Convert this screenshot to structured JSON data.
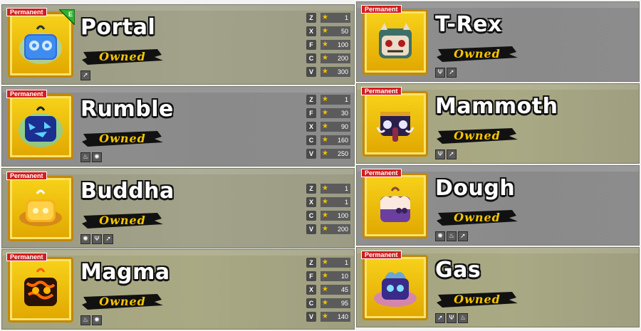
{
  "left_column": [
    {
      "name": "Portal",
      "tag": "Permanent",
      "status": "Owned",
      "badge": "E",
      "icon": "portal-fruit-icon",
      "abilities": [
        "dash-icon"
      ],
      "moves": [
        {
          "key": "Z",
          "mastery": "1"
        },
        {
          "key": "X",
          "mastery": "50"
        },
        {
          "key": "F",
          "mastery": "100"
        },
        {
          "key": "C",
          "mastery": "200"
        },
        {
          "key": "V",
          "mastery": "300"
        }
      ]
    },
    {
      "name": "Rumble",
      "tag": "Permanent",
      "status": "Owned",
      "icon": "rumble-fruit-icon",
      "abilities": [
        "fire-icon",
        "gear-icon"
      ],
      "moves": [
        {
          "key": "Z",
          "mastery": "1"
        },
        {
          "key": "F",
          "mastery": "30"
        },
        {
          "key": "X",
          "mastery": "90"
        },
        {
          "key": "C",
          "mastery": "160"
        },
        {
          "key": "V",
          "mastery": "250"
        }
      ]
    },
    {
      "name": "Buddha",
      "tag": "Permanent",
      "status": "Owned",
      "icon": "buddha-fruit-icon",
      "abilities": [
        "gear-icon",
        "claw-icon",
        "dash-icon"
      ],
      "moves": [
        {
          "key": "Z",
          "mastery": "1"
        },
        {
          "key": "X",
          "mastery": "1"
        },
        {
          "key": "C",
          "mastery": "100"
        },
        {
          "key": "V",
          "mastery": "200"
        }
      ]
    },
    {
      "name": "Magma",
      "tag": "Permanent",
      "status": "Owned",
      "icon": "magma-fruit-icon",
      "abilities": [
        "fire-icon",
        "gear-icon"
      ],
      "moves": [
        {
          "key": "Z",
          "mastery": "1"
        },
        {
          "key": "F",
          "mastery": "10"
        },
        {
          "key": "X",
          "mastery": "45"
        },
        {
          "key": "C",
          "mastery": "95"
        },
        {
          "key": "V",
          "mastery": "140"
        }
      ]
    }
  ],
  "right_column": [
    {
      "name": "T-Rex",
      "tag": "Permanent",
      "status": "Owned",
      "icon": "t-rex-fruit-icon",
      "abilities": [
        "claw-icon",
        "dash-icon"
      ]
    },
    {
      "name": "Mammoth",
      "tag": "Permanent",
      "status": "Owned",
      "icon": "mammoth-fruit-icon",
      "abilities": [
        "claw-icon",
        "dash-icon"
      ]
    },
    {
      "name": "Dough",
      "tag": "Permanent",
      "status": "Owned",
      "icon": "dough-fruit-icon",
      "abilities": [
        "gear-icon",
        "fire-icon",
        "dash-icon"
      ]
    },
    {
      "name": "Gas",
      "tag": "Permanent",
      "status": "Owned",
      "icon": "gas-fruit-icon",
      "abilities": [
        "dash-icon",
        "claw-icon",
        "fire-icon"
      ]
    }
  ],
  "colors": {
    "permanent_tag": "#d11e1e",
    "owned_text": "#f5c400",
    "frame_gold": "#e1a700",
    "star": "#f2c200"
  }
}
